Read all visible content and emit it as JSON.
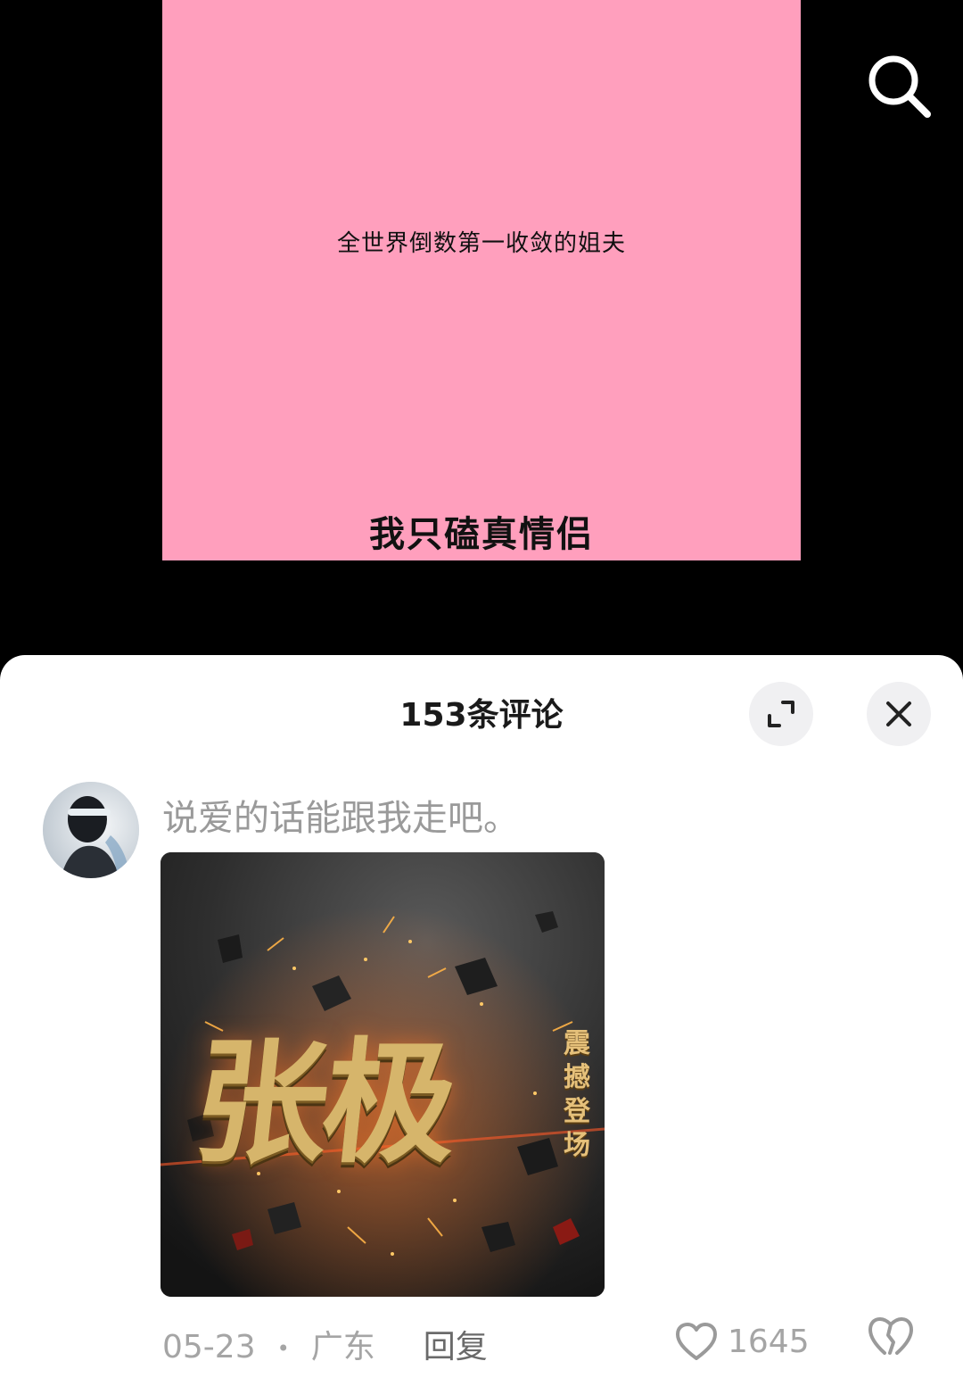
{
  "video": {
    "subtitle": "全世界倒数第一收敛的姐夫",
    "title": "我只磕真情侣",
    "background_color": "#ff9fbd",
    "search_icon": "search-icon"
  },
  "sheet": {
    "title": "153条评论",
    "expand_icon": "expand-icon",
    "close_icon": "close-icon"
  },
  "comment": {
    "text": "说爱的话能跟我走吧。",
    "image": {
      "main_text": "张极",
      "side_text": "震撼登场"
    },
    "date": "05-23",
    "separator": "•",
    "location": "广东",
    "reply_label": "回复",
    "like_count": "1645",
    "like_icon": "heart-icon",
    "dislike_icon": "dislike-icon"
  }
}
